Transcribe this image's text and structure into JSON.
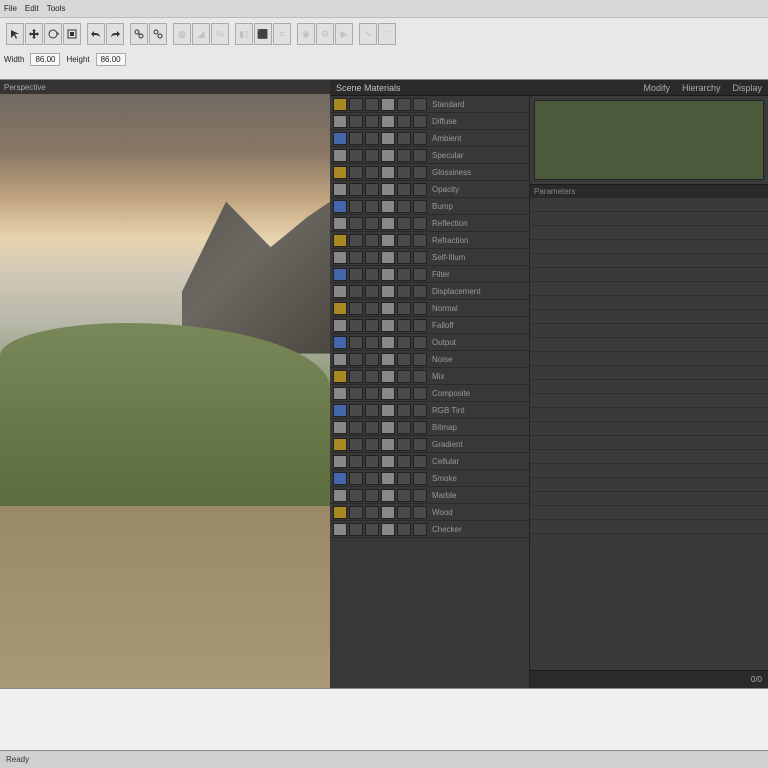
{
  "menu": {
    "items": [
      "File",
      "Edit",
      "Tools"
    ]
  },
  "toolbar": {
    "fields": [
      {
        "label": "Width",
        "value": "86.00"
      },
      {
        "label": "Height",
        "value": "86.00"
      }
    ]
  },
  "viewport": {
    "label": "Perspective"
  },
  "panel": {
    "title": "Scene Materials",
    "tabs": [
      "Modify",
      "Hierarchy",
      "Display"
    ],
    "controls": [
      {
        "label": "Standard",
        "lit": "y"
      },
      {
        "label": "Diffuse",
        "lit": "w"
      },
      {
        "label": "Ambient",
        "lit": "b"
      },
      {
        "label": "Specular",
        "lit": "w"
      },
      {
        "label": "Glossiness",
        "lit": "y"
      },
      {
        "label": "Opacity",
        "lit": "w"
      },
      {
        "label": "Bump",
        "lit": "b"
      },
      {
        "label": "Reflection",
        "lit": "w"
      },
      {
        "label": "Refraction",
        "lit": "y"
      },
      {
        "label": "Self-Illum",
        "lit": "w"
      },
      {
        "label": "Filter",
        "lit": "b"
      },
      {
        "label": "Displacement",
        "lit": "w"
      },
      {
        "label": "Normal",
        "lit": "y"
      },
      {
        "label": "Falloff",
        "lit": "w"
      },
      {
        "label": "Output",
        "lit": "b"
      },
      {
        "label": "Noise",
        "lit": "w"
      },
      {
        "label": "Mix",
        "lit": "y"
      },
      {
        "label": "Composite",
        "lit": "w"
      },
      {
        "label": "RGB Tint",
        "lit": "b"
      },
      {
        "label": "Bitmap",
        "lit": "w"
      },
      {
        "label": "Gradient",
        "lit": "y"
      },
      {
        "label": "Cellular",
        "lit": "w"
      },
      {
        "label": "Smoke",
        "lit": "b"
      },
      {
        "label": "Marble",
        "lit": "w"
      },
      {
        "label": "Wood",
        "lit": "y"
      },
      {
        "label": "Checker",
        "lit": "w"
      }
    ],
    "props_header": "Parameters",
    "props": [
      {
        "name": "",
        "val": ""
      },
      {
        "name": "",
        "val": ""
      },
      {
        "name": "",
        "val": ""
      },
      {
        "name": "",
        "val": ""
      },
      {
        "name": "",
        "val": ""
      },
      {
        "name": "",
        "val": ""
      },
      {
        "name": "",
        "val": ""
      },
      {
        "name": "",
        "val": ""
      },
      {
        "name": "",
        "val": ""
      },
      {
        "name": "",
        "val": ""
      },
      {
        "name": "",
        "val": ""
      },
      {
        "name": "",
        "val": ""
      },
      {
        "name": "",
        "val": ""
      },
      {
        "name": "",
        "val": ""
      },
      {
        "name": "",
        "val": ""
      },
      {
        "name": "",
        "val": ""
      },
      {
        "name": "",
        "val": ""
      },
      {
        "name": "",
        "val": ""
      },
      {
        "name": "",
        "val": ""
      },
      {
        "name": "",
        "val": ""
      },
      {
        "name": "",
        "val": ""
      },
      {
        "name": "",
        "val": ""
      },
      {
        "name": "",
        "val": ""
      },
      {
        "name": "",
        "val": ""
      }
    ],
    "footer": {
      "page": "0/0"
    }
  },
  "status": {
    "items": [
      "Ready"
    ]
  }
}
